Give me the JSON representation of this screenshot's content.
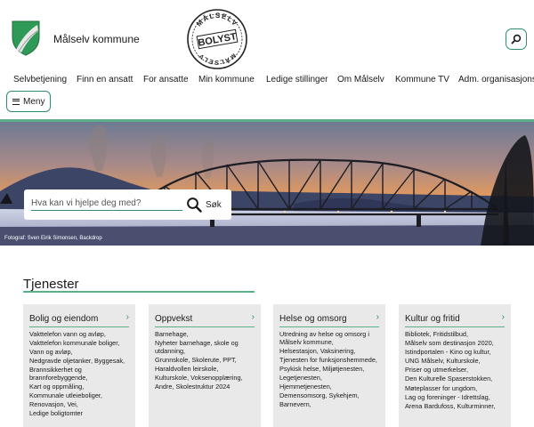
{
  "header": {
    "site_title": "Målselv kommune",
    "stamp_ring_top": "MÅLSELV",
    "stamp_center": "BOLYST",
    "stamp_ring_bottom": "MÅLSELV",
    "search_toggle_icon": "search-icon"
  },
  "nav": [
    {
      "label": "Selvbetjening"
    },
    {
      "label": "Finn en ansatt"
    },
    {
      "label": "For ansatte"
    },
    {
      "label": "Min kommune"
    },
    {
      "label": "Ledige stillinger"
    },
    {
      "label": "Om Målselv"
    },
    {
      "label": "Kommune TV"
    },
    {
      "label": "Adm. organisasjonskart"
    }
  ],
  "menu": {
    "label": "Meny",
    "icon": "hamburger-icon"
  },
  "hero": {
    "search_placeholder": "Hva kan vi hjelpe deg med?",
    "search_value": "",
    "search_button": "Søk",
    "photo_credit": "Fotograf: Sven Eirik Simonsen, Backdrop"
  },
  "services": {
    "title": "Tjenester",
    "cards": [
      {
        "title": "Bolig og eiendom",
        "items": [
          "Vakttelefon vann og avløp,",
          "Vakttelefon kommunale boliger,",
          "Vann og avløp,",
          "Nedgravde oljetanker, Byggesak,",
          "Brannsikkerhet og brannforebyggende,",
          "Kart og oppmåling,",
          "Kommunale utleieboliger,",
          "Renovasjon, Vei,",
          "Ledige boligtomter"
        ]
      },
      {
        "title": "Oppvekst",
        "items": [
          "Barnehage,",
          "Nyheter barnehage, skole og utdanning,",
          "Grunnskole, Skolerute, PPT,",
          "Haraldvollen leirskole,",
          "Kulturskole, Voksenopplæring,",
          "Andre, Skolestruktur 2024"
        ]
      },
      {
        "title": "Helse og omsorg",
        "items": [
          "Utredning av helse og omsorg i Målselv kommune,",
          "Helsestasjon, Vaksinering,",
          "Tjenesten for funksjonshemmede,",
          "Psykisk helse, Miljøtjenesten,",
          "Legetjenesten,",
          "Hjemmetjenesten,",
          "Demensomsorg, Sykehjem,",
          "Barnevern,"
        ]
      },
      {
        "title": "Kultur og fritid",
        "items": [
          "Bibliotek, Fritidstilbud,",
          "Målselv som destinasjon 2020,",
          "Istindportalen - Kino og kultur,",
          "UNG Målselv, Kulturskole,",
          "Priser og utmerkelser,",
          "Den Kulturelle Spaserstokken,",
          "Møteplasser for ungdom,",
          "Lag og foreninger - Idrettslag,",
          "Arena Bardufoss, Kulturminner,"
        ]
      }
    ]
  },
  "colors": {
    "accent_green": "#2e8f6a",
    "rule_green": "#5fae8a",
    "card_bg": "#e9e9e9"
  }
}
